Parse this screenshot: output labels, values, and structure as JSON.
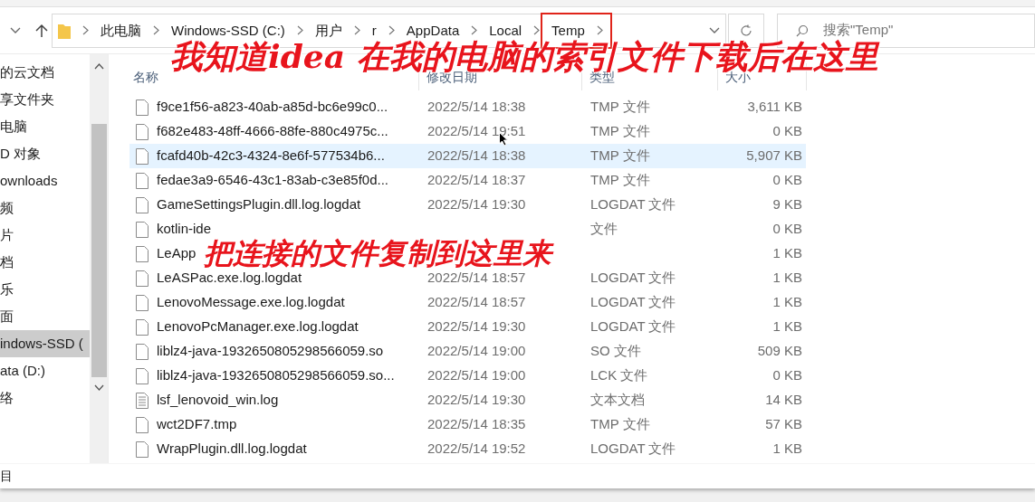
{
  "address_bar": {
    "crumbs": [
      {
        "label": "此电脑",
        "highlighted": false
      },
      {
        "label": "Windows-SSD (C:)",
        "highlighted": false
      },
      {
        "label": "用户",
        "highlighted": false
      },
      {
        "label": "r",
        "highlighted": false
      },
      {
        "label": "AppData",
        "highlighted": false
      },
      {
        "label": "Local",
        "highlighted": false
      },
      {
        "label": "Temp",
        "highlighted": true
      }
    ],
    "search_placeholder": "搜索\"Temp\""
  },
  "sidebar": {
    "items": [
      {
        "label": "的云文档",
        "selected": false
      },
      {
        "label": "享文件夹",
        "selected": false
      },
      {
        "label": "电脑",
        "selected": false
      },
      {
        "label": "D 对象",
        "selected": false
      },
      {
        "label": "ownloads",
        "selected": false
      },
      {
        "label": "频",
        "selected": false
      },
      {
        "label": "片",
        "selected": false
      },
      {
        "label": "档",
        "selected": false
      },
      {
        "label": "乐",
        "selected": false
      },
      {
        "label": "面",
        "selected": false
      },
      {
        "label": "indows-SSD (",
        "selected": true
      },
      {
        "label": "ata (D:)",
        "selected": false
      },
      {
        "label": "络",
        "selected": false
      }
    ]
  },
  "table": {
    "columns": [
      "名称",
      "修改日期",
      "类型",
      "大小"
    ],
    "rows": [
      {
        "kind": "file",
        "name": "f9ce1f56-a823-40ab-a85d-bc6e99c0...",
        "modified": "2022/5/14 18:38",
        "type": "TMP 文件",
        "size": "3,611 KB",
        "selected": false
      },
      {
        "kind": "file",
        "name": "f682e483-48ff-4666-88fe-880c4975c...",
        "modified": "2022/5/14 19:51",
        "type": "TMP 文件",
        "size": "0 KB",
        "selected": false
      },
      {
        "kind": "file",
        "name": "fcafd40b-42c3-4324-8e6f-577534b6...",
        "modified": "2022/5/14 18:38",
        "type": "TMP 文件",
        "size": "5,907 KB",
        "selected": true
      },
      {
        "kind": "file",
        "name": "fedae3a9-6546-43c1-83ab-c3e85f0d...",
        "modified": "2022/5/14 18:37",
        "type": "TMP 文件",
        "size": "0 KB",
        "selected": false
      },
      {
        "kind": "file",
        "name": "GameSettingsPlugin.dll.log.logdat",
        "modified": "2022/5/14 19:30",
        "type": "LOGDAT 文件",
        "size": "9 KB",
        "selected": false
      },
      {
        "kind": "file",
        "name": "kotlin-ide",
        "type": "文件",
        "size": "0 KB",
        "selected": false
      },
      {
        "kind": "file",
        "name": "LeApp",
        "size": "1 KB",
        "selected": false,
        "annotation": "把连接的文件复制到这里来"
      },
      {
        "kind": "file",
        "name": "LeASPac.exe.log.logdat",
        "modified": "2022/5/14 18:57",
        "type": "LOGDAT 文件",
        "size": "1 KB",
        "selected": false
      },
      {
        "kind": "file",
        "name": "LenovoMessage.exe.log.logdat",
        "modified": "2022/5/14 18:57",
        "type": "LOGDAT 文件",
        "size": "1 KB",
        "selected": false
      },
      {
        "kind": "file",
        "name": "LenovoPcManager.exe.log.logdat",
        "modified": "2022/5/14 19:30",
        "type": "LOGDAT 文件",
        "size": "1 KB",
        "selected": false
      },
      {
        "kind": "file",
        "name": "liblz4-java-1932650805298566059.so",
        "modified": "2022/5/14 19:00",
        "type": "SO 文件",
        "size": "509 KB",
        "selected": false
      },
      {
        "kind": "file",
        "name": "liblz4-java-1932650805298566059.so...",
        "modified": "2022/5/14 19:00",
        "type": "LCK 文件",
        "size": "0 KB",
        "selected": false
      },
      {
        "kind": "text",
        "name": "lsf_lenovoid_win.log",
        "modified": "2022/5/14 19:30",
        "type": "文本文档",
        "size": "14 KB",
        "selected": false
      },
      {
        "kind": "file",
        "name": "wct2DF7.tmp",
        "modified": "2022/5/14 18:35",
        "type": "TMP 文件",
        "size": "57 KB",
        "selected": false
      },
      {
        "kind": "file",
        "name": "WrapPlugin.dll.log.logdat",
        "modified": "2022/5/14 19:52",
        "type": "LOGDAT 文件",
        "size": "1 KB",
        "selected": false
      }
    ]
  },
  "status_bar": "目",
  "annotations": [
    "我知道idea 在我的电脑的索引文件下载后在这里"
  ]
}
